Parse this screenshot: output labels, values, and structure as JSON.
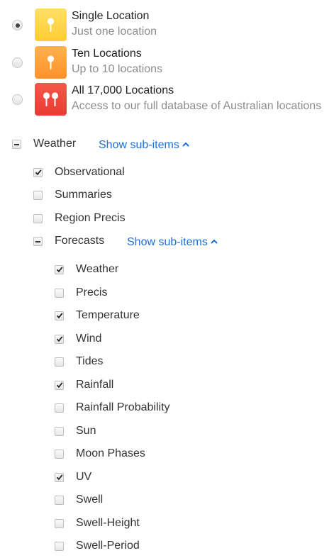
{
  "plans": [
    {
      "title": "Single Location",
      "subtitle": "Just one location",
      "selected": true,
      "color": "#ffd54a",
      "icon": "single-pin-icon"
    },
    {
      "title": "Ten Locations",
      "subtitle": "Up to 10 locations",
      "selected": false,
      "color": "#ffa43a",
      "icon": "single-pin-icon"
    },
    {
      "title": "All 17,000 Locations",
      "subtitle": "Access to our full database of Australian locations",
      "selected": false,
      "color": "#f04a3c",
      "icon": "double-pin-icon"
    }
  ],
  "tree": {
    "label": "Weather",
    "state": "partial",
    "toggle_label": "Show sub-items",
    "children": [
      {
        "label": "Observational",
        "checked": true
      },
      {
        "label": "Summaries",
        "checked": false
      },
      {
        "label": "Region Precis",
        "checked": false
      },
      {
        "label": "Forecasts",
        "state": "partial",
        "toggle_label": "Show sub-items",
        "children": [
          {
            "label": "Weather",
            "checked": true
          },
          {
            "label": "Precis",
            "checked": false
          },
          {
            "label": "Temperature",
            "checked": true
          },
          {
            "label": "Wind",
            "checked": true
          },
          {
            "label": "Tides",
            "checked": false
          },
          {
            "label": "Rainfall",
            "checked": true
          },
          {
            "label": "Rainfall Probability",
            "checked": false
          },
          {
            "label": "Sun",
            "checked": false
          },
          {
            "label": "Moon Phases",
            "checked": false
          },
          {
            "label": "UV",
            "checked": true
          },
          {
            "label": "Swell",
            "checked": false
          },
          {
            "label": "Swell-Height",
            "checked": false
          },
          {
            "label": "Swell-Period",
            "checked": false
          }
        ]
      }
    ]
  },
  "colors": {
    "link": "#1e6fd9",
    "text": "#333333",
    "muted": "#8c8c8c"
  }
}
